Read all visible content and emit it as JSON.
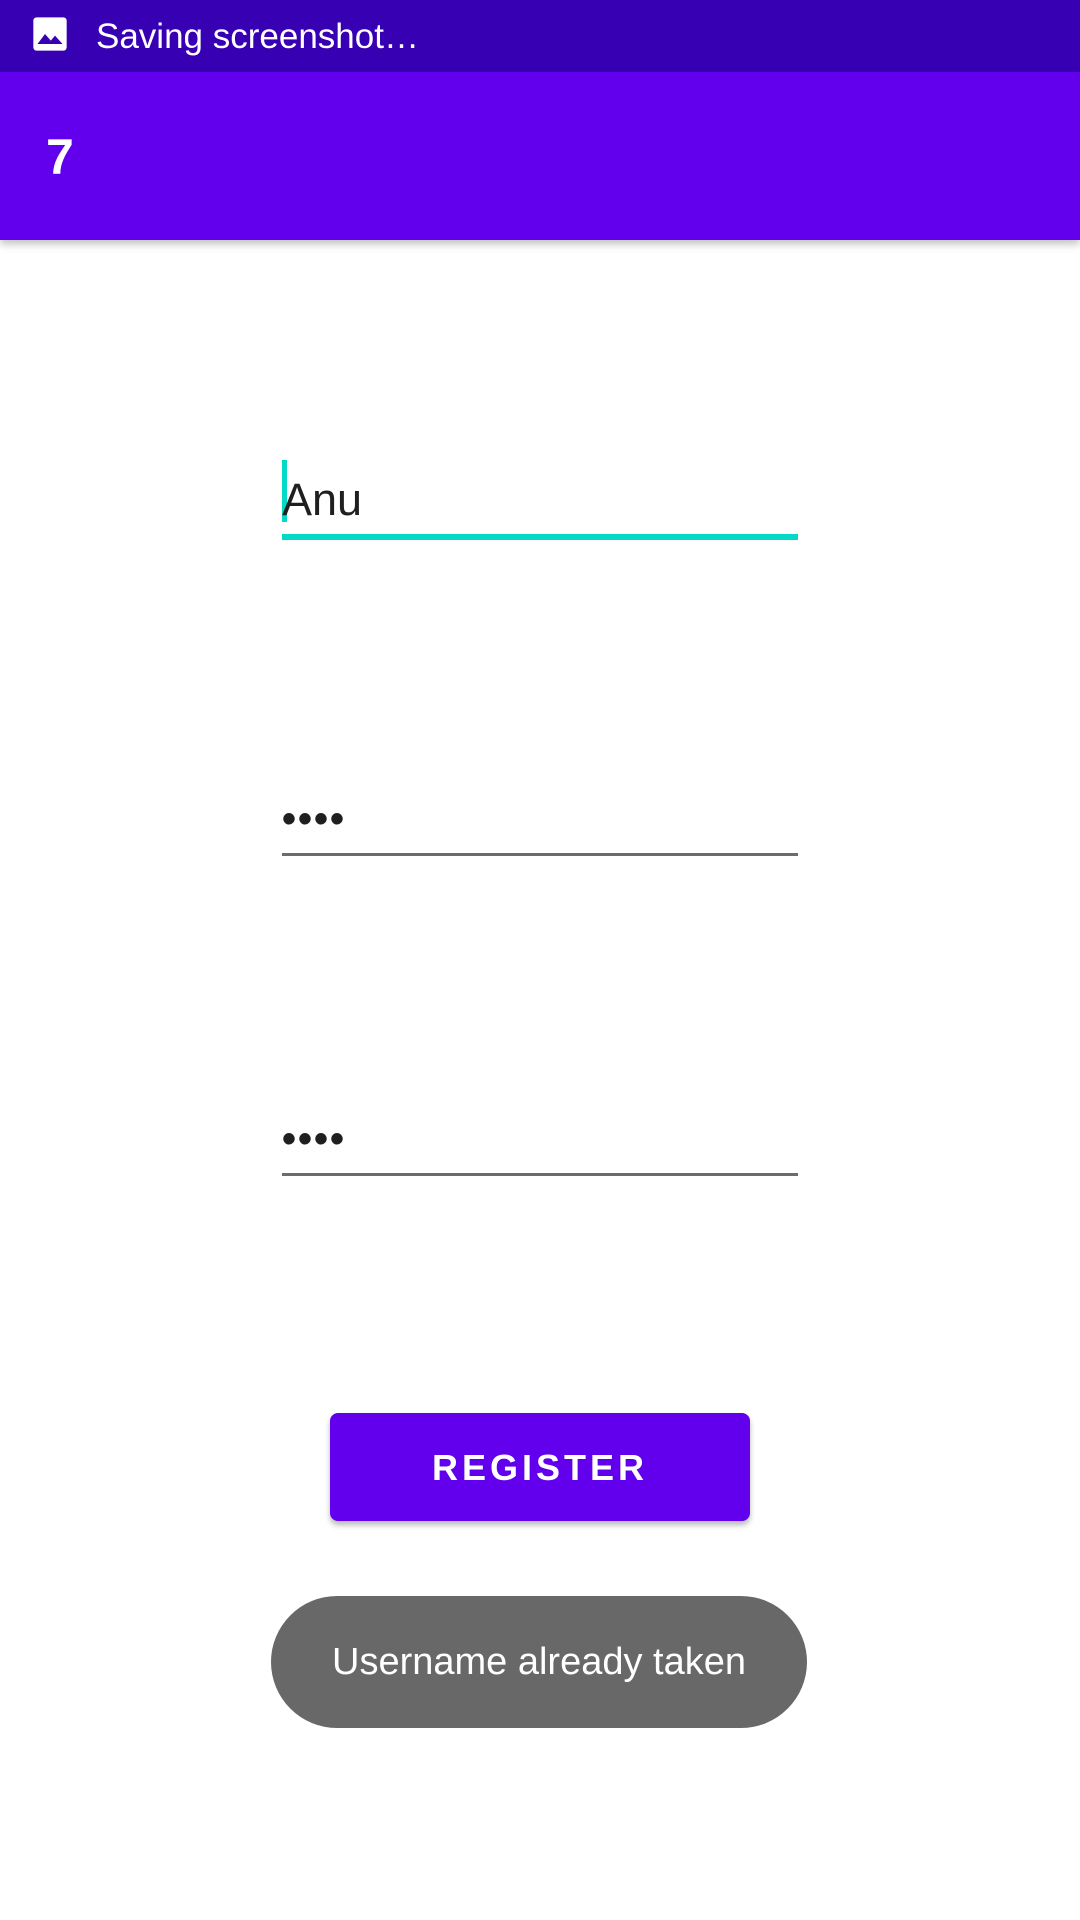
{
  "status_bar": {
    "notification_icon": "image-icon",
    "text": "Saving screenshot…"
  },
  "app_bar": {
    "title": "7"
  },
  "form": {
    "username_value": "Anu",
    "password_masked": "••••",
    "confirm_password_masked": "••••",
    "register_label": "REGISTER"
  },
  "toast": {
    "message": "Username already taken"
  },
  "colors": {
    "status_bar": "#3700b3",
    "primary": "#6200ee",
    "accent": "#03dac5",
    "toast": "#686868"
  }
}
